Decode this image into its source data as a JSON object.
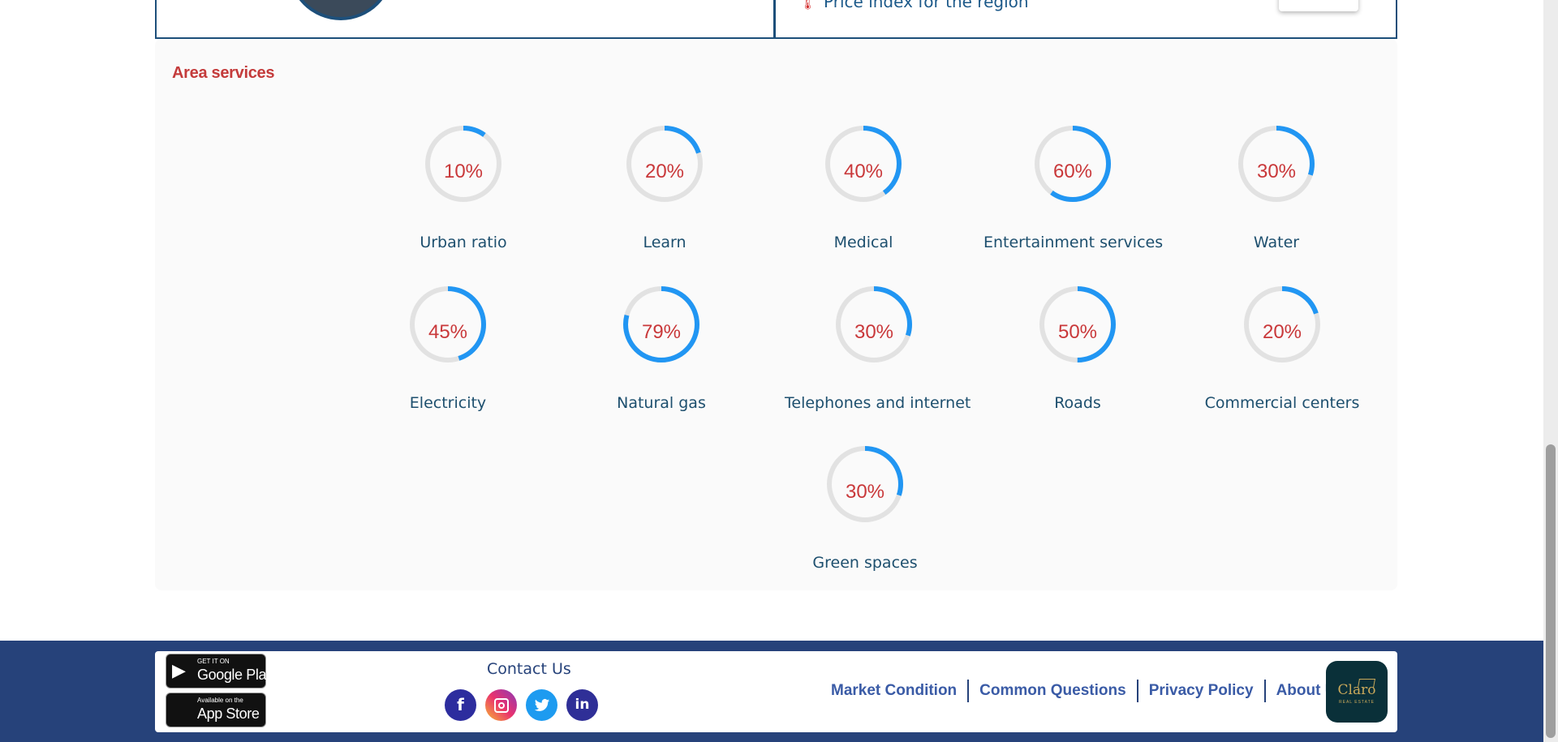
{
  "top": {
    "price_index_icon": "thermometer-icon",
    "price_index_label": "Price index for the region"
  },
  "services": {
    "title": "Area services",
    "ring_color": "#2196f3",
    "track_color": "#e2e2e2",
    "items": [
      {
        "label": "Urban ratio",
        "percent": 10,
        "percent_text": "10%"
      },
      {
        "label": "Learn",
        "percent": 20,
        "percent_text": "20%"
      },
      {
        "label": "Medical",
        "percent": 40,
        "percent_text": "40%"
      },
      {
        "label": "Entertainment services",
        "percent": 60,
        "percent_text": "60%"
      },
      {
        "label": "Water",
        "percent": 30,
        "percent_text": "30%"
      },
      {
        "label": "Electricity",
        "percent": 45,
        "percent_text": "45%"
      },
      {
        "label": "Natural gas",
        "percent": 79,
        "percent_text": "79%"
      },
      {
        "label": "Telephones and internet",
        "percent": 30,
        "percent_text": "30%"
      },
      {
        "label": "Roads",
        "percent": 50,
        "percent_text": "50%"
      },
      {
        "label": "Commercial centers",
        "percent": 20,
        "percent_text": "20%"
      },
      {
        "label": "Green spaces",
        "percent": 30,
        "percent_text": "30%"
      }
    ]
  },
  "footer": {
    "google_play": {
      "small": "GET IT ON",
      "big": "Google Play"
    },
    "app_store": {
      "small": "Available on the",
      "big": "App Store"
    },
    "contact_title": "Contact Us",
    "social": [
      {
        "icon": "facebook-icon",
        "glyph": "f"
      },
      {
        "icon": "instagram-icon",
        "glyph": ""
      },
      {
        "icon": "twitter-icon",
        "glyph": "🐦"
      },
      {
        "icon": "linkedin-icon",
        "glyph": "in"
      }
    ],
    "links": [
      "Market Condition",
      "Common Questions",
      "Privacy Policy",
      "About Us"
    ],
    "logo_text": "Claro",
    "logo_sub": "REAL ESTATE"
  }
}
